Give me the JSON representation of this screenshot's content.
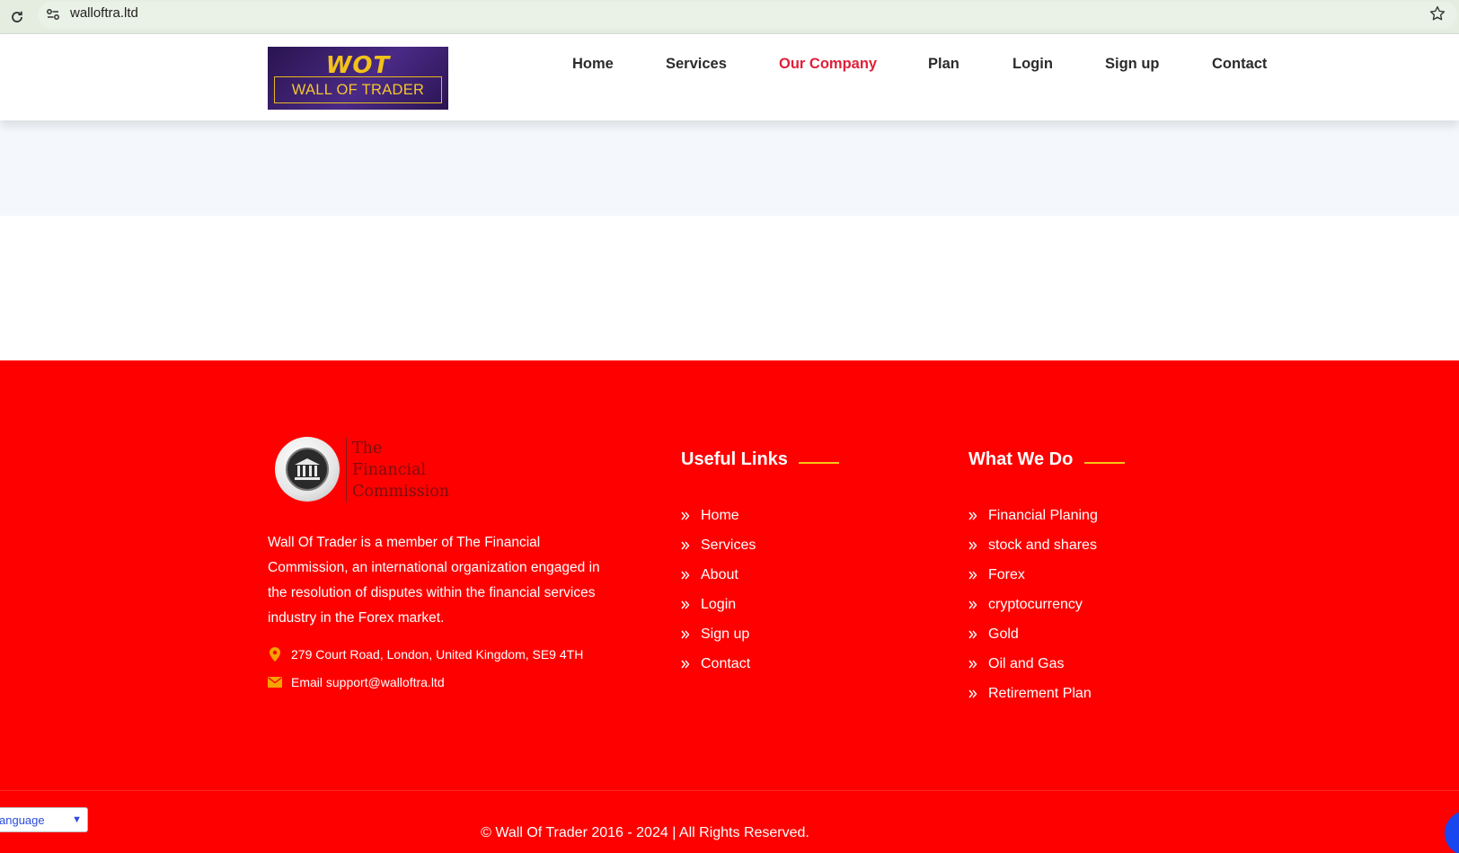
{
  "browser": {
    "url": "walloftra.ltd"
  },
  "header": {
    "logo_mark": "WOT",
    "logo_text": "WALL OF TRADER",
    "nav": [
      {
        "label": "Home",
        "active": false
      },
      {
        "label": "Services",
        "active": false
      },
      {
        "label": "Our Company",
        "active": true
      },
      {
        "label": "Plan",
        "active": false
      },
      {
        "label": "Login",
        "active": false
      },
      {
        "label": "Sign up",
        "active": false
      },
      {
        "label": "Contact",
        "active": false
      }
    ],
    "active_color": "#e0203a"
  },
  "footer": {
    "background": "#ff0000",
    "accent": "#f5c518",
    "partner": {
      "name_lines": [
        "The",
        "Financial",
        "Commission"
      ]
    },
    "about": "Wall Of Trader is a member of The Financial Commission, an international organization engaged in the resolution of disputes within the financial services industry in the Forex market.",
    "address": "279 Court Road, London, United Kingdom, SE9 4TH",
    "email": "Email support@walloftra.ltd",
    "useful_links": {
      "title": "Useful Links",
      "items": [
        "Home",
        "Services",
        "About",
        "Login",
        "Sign up",
        "Contact"
      ]
    },
    "what_we_do": {
      "title": "What We Do",
      "items": [
        "Financial Planing",
        "stock and shares",
        "Forex",
        "cryptocurrency",
        "Gold",
        "Oil and Gas",
        "Retirement Plan"
      ]
    },
    "copyright": "© Wall Of Trader 2016 - 2024 | All Rights Reserved."
  },
  "widgets": {
    "language_select": "anguage"
  },
  "icons": {
    "reload": "reload-icon",
    "site_info": "site-info-icon",
    "bookmark": "star-icon",
    "location": "map-pin-icon",
    "email": "envelope-icon",
    "link_bullet": "double-chevron-right-icon"
  }
}
